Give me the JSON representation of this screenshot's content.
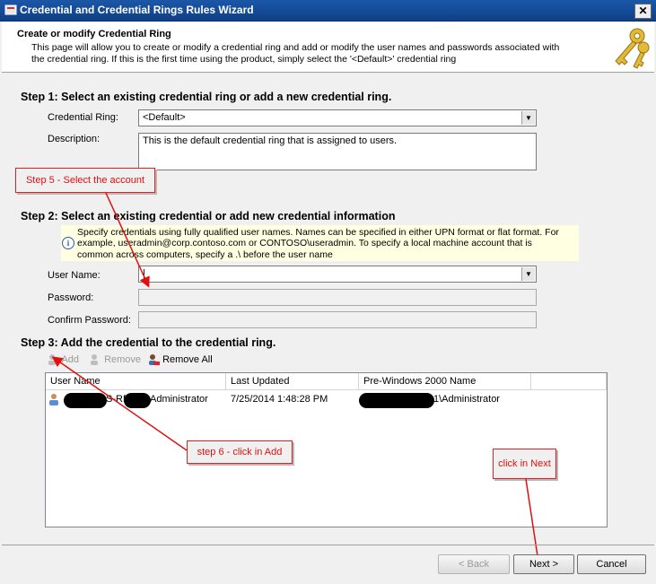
{
  "window": {
    "title": "Credential and Credential Rings Rules Wizard",
    "close_glyph": "✕"
  },
  "header": {
    "title": "Create or modify Credential Ring",
    "description": "This page will allow you to create or modify a credential ring and add or modify the user names and passwords associated with the credential ring. If this is the first time using the product, simply select the '<Default>' credential ring"
  },
  "step1": {
    "heading": "Step 1: Select an existing credential ring or add a new credential ring.",
    "ring_label": "Credential Ring:",
    "ring_value": "<Default>",
    "description_label": "Description:",
    "description_value": "This is the default credential ring that is assigned to users."
  },
  "step2": {
    "heading": "Step 2: Select an existing credential  or add new credential information",
    "info": "Specify credentials using fully qualified user names. Names can be specified in either UPN format or flat format. For example, useradmin@corp.contoso.com  or CONTOSO\\useradmin. To specify a local machine account that is common across computers, specify a .\\ before the user name",
    "username_label": "User Name:",
    "username_value": "|",
    "password_label": "Password:",
    "confirm_label": "Confirm Password:"
  },
  "step3": {
    "heading": "Step 3: Add the credential to the credential ring.",
    "toolbar": {
      "add": "Add",
      "remove": "Remove",
      "remove_all": "Remove All"
    },
    "columns": [
      "User Name",
      "Last Updated",
      "Pre-Windows 2000 Name"
    ],
    "rows": [
      {
        "user_suffix_a": "S-RD",
        "user_suffix_b": "Administrator",
        "last_updated": "7/25/2014 1:48:28 PM",
        "prewin_suffix": "1\\Administrator"
      }
    ]
  },
  "buttons": {
    "back": "< Back",
    "next": "Next >",
    "cancel": "Cancel"
  },
  "annotations": {
    "step5": "Step 5 - Select the account",
    "step6": "step 6 - click in Add",
    "next": "click in Next"
  },
  "icons": [
    "window-icon",
    "keys-icon",
    "info-icon",
    "add-user-icon",
    "remove-user-icon",
    "remove-all-icon",
    "user-icon",
    "dropdown-arrow-icon"
  ],
  "colors": {
    "titlebar": "#1b57a8",
    "info_bg": "#ffffe1",
    "callout_red": "#e01010"
  }
}
